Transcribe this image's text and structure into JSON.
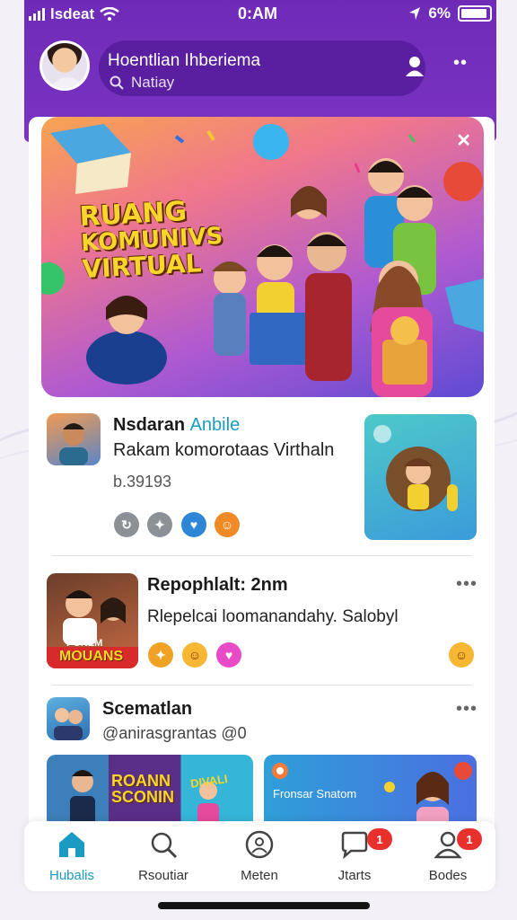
{
  "status_bar": {
    "carrier": "lsdeat",
    "time": "0:AM",
    "battery": "6%"
  },
  "header": {
    "title": "Hoentlian Ihberiema",
    "search_placeholder": "Natiay"
  },
  "banner": {
    "title_lines": [
      "RUANG",
      "KOMUNIVS",
      "VIRTUAL"
    ],
    "close_icon": "close-icon"
  },
  "posts": [
    {
      "name": "Nsdaran",
      "tag": "Anbile",
      "text": "Rakam komorotaas Virthaln",
      "meta": "b.39193",
      "reactions": [
        "share",
        "puzzle",
        "heart",
        "smile"
      ]
    },
    {
      "name": "Repophlalt: 2nm",
      "text": "Rlepelcai loomanandahy. Salobyl",
      "thumb_labels": [
        "PONEM",
        "MOUANS"
      ],
      "reactions": [
        "fire",
        "laugh",
        "love"
      ],
      "end_reaction": "smile"
    },
    {
      "name": "Scematlan",
      "handle": "@anirasgrantas @0",
      "media": [
        {
          "title_lines": [
            "ROANN",
            "SCONIN"
          ],
          "caption": "DIVALI"
        },
        {
          "caption": "Fronsar Snatom"
        }
      ]
    }
  ],
  "nav": {
    "items": [
      {
        "label": "Hubalis",
        "badge": ""
      },
      {
        "label": "Rsoutiar",
        "badge": ""
      },
      {
        "label": "Meten",
        "badge": ""
      },
      {
        "label": "Jtarts",
        "badge": "1"
      },
      {
        "label": "Bodes",
        "badge": "1"
      }
    ]
  },
  "colors": {
    "brand": "#7a33c2",
    "accent": "#1a9bc2",
    "badge": "#e8302c"
  }
}
